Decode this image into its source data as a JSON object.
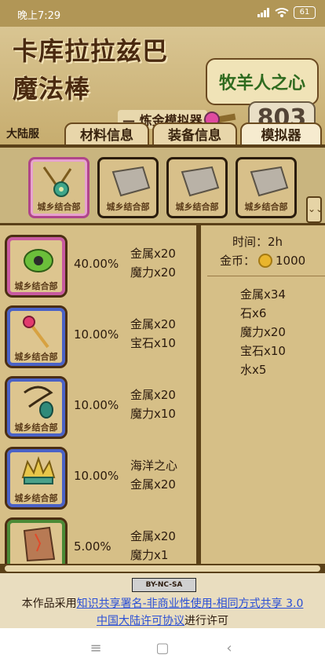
{
  "status": {
    "time": "晚上7:29",
    "battery": "61"
  },
  "header": {
    "title_line1": "卡库拉拉兹巴",
    "title_line2": "魔法棒",
    "subtitle": "— 炼金模拟器",
    "logo_text": "牧羊人之心",
    "score": "803"
  },
  "tabs": {
    "small": "大陆服",
    "items": [
      "材料信息",
      "装备信息",
      "模拟器"
    ],
    "active": "模拟器"
  },
  "strip": {
    "label": "城乡结合部",
    "slots": [
      "amulet",
      "stone",
      "stone",
      "stone"
    ]
  },
  "recipes": [
    {
      "percent": "40.00%",
      "mats": [
        "金属x20",
        "魔力x20"
      ],
      "label": "城乡结合部"
    },
    {
      "percent": "10.00%",
      "mats": [
        "金属x20",
        "宝石x10"
      ],
      "label": "城乡结合部"
    },
    {
      "percent": "10.00%",
      "mats": [
        "金属x20",
        "魔力x10"
      ],
      "label": "城乡结合部"
    },
    {
      "percent": "10.00%",
      "mats": [
        "海洋之心",
        "金属x20"
      ],
      "label": "城乡结合部"
    },
    {
      "percent": "5.00%",
      "mats": [
        "金属x20",
        "魔力x1"
      ],
      "label": ""
    }
  ],
  "summary": {
    "time": "时间：2h",
    "gold_label": "金币：",
    "gold_value": "1000",
    "totals": [
      "金属x34",
      "石x6",
      "魔力x20",
      "宝石x10",
      "水x5"
    ]
  },
  "license": {
    "cc_badge": "BY-NC-SA",
    "prefix": "本作品采用",
    "link1": "知识共享署名-非商业性使用-相同方式共享 3.0",
    "link2": "中国大陆许可协议",
    "suffix": "进行许可"
  },
  "navbar": {
    "menu_icon": "≡",
    "home_icon": "▢",
    "back_icon": "‹"
  }
}
